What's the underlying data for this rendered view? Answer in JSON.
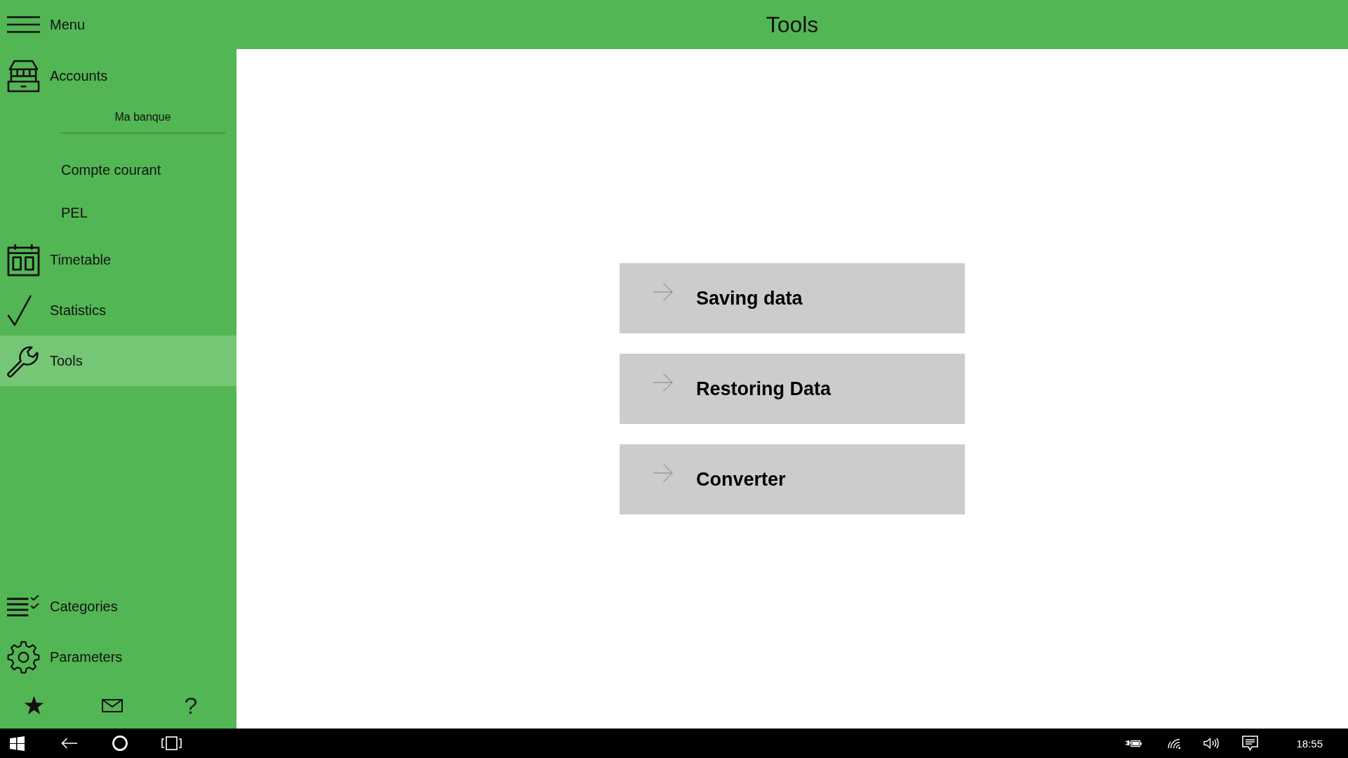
{
  "header": {
    "menu_label": "Menu",
    "title": "Tools"
  },
  "sidebar": {
    "items": [
      {
        "label": "Accounts",
        "selected": false,
        "children": [
          {
            "label": "Ma banque",
            "children": [
              {
                "label": "Compte courant",
                "selected": false
              },
              {
                "label": "PEL",
                "selected": false
              }
            ]
          }
        ]
      },
      {
        "label": "Timetable",
        "selected": false
      },
      {
        "label": "Statistics",
        "selected": false
      },
      {
        "label": "Tools",
        "selected": true
      }
    ],
    "bottom_items": [
      {
        "label": "Categories",
        "selected": false
      },
      {
        "label": "Parameters",
        "selected": false
      }
    ],
    "help_label": "?"
  },
  "actions": [
    {
      "label": "Saving data"
    },
    {
      "label": "Restoring Data"
    },
    {
      "label": "Converter"
    }
  ],
  "taskbar": {
    "clock": "18:55"
  }
}
